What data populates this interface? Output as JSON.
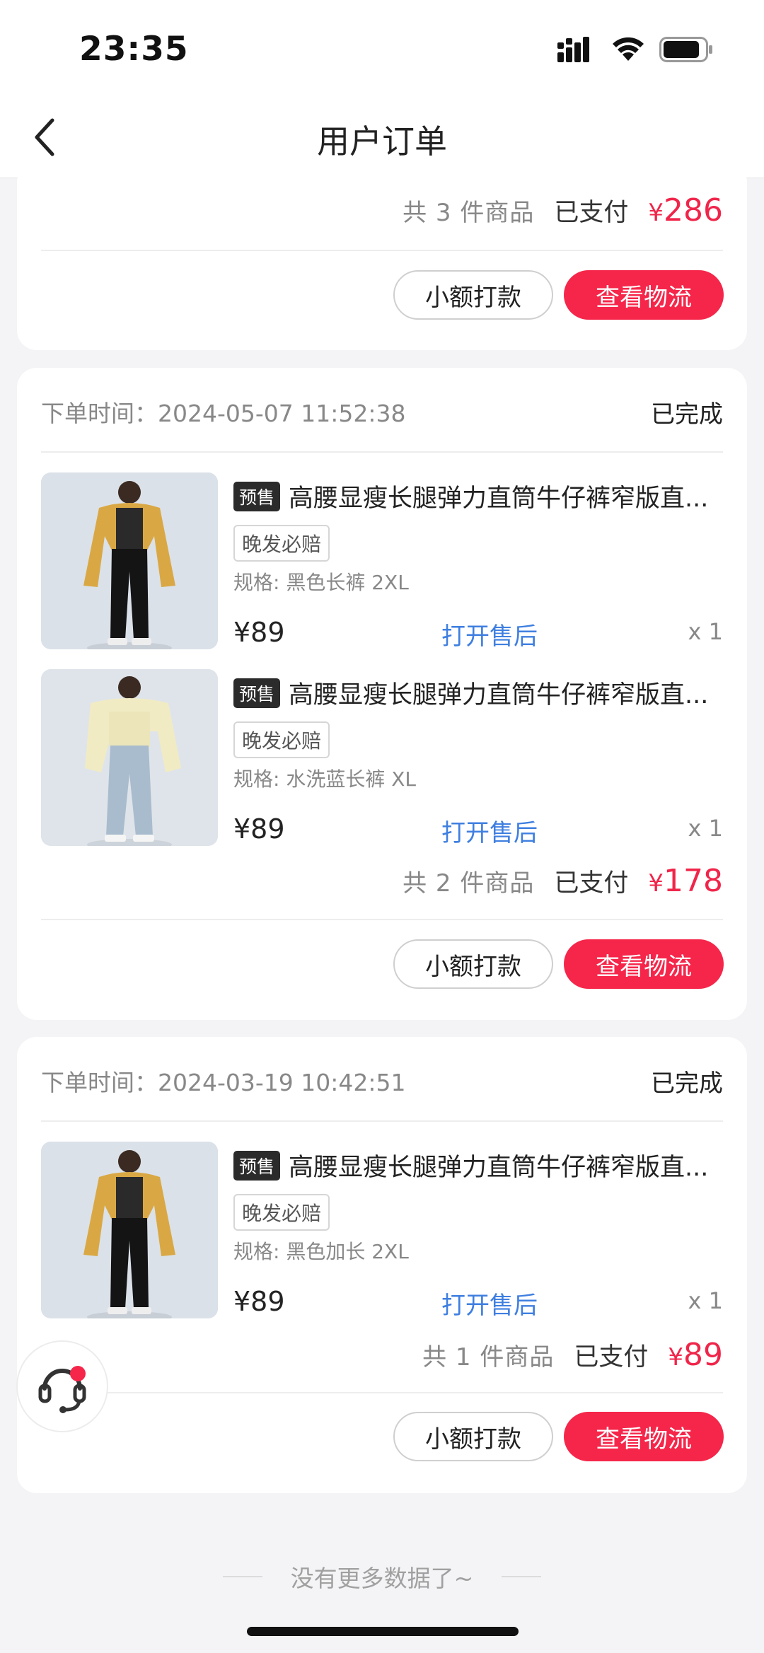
{
  "status_bar": {
    "time": "23:35"
  },
  "nav": {
    "title": "用户订单"
  },
  "orders": [
    {
      "summary": {
        "count": "共 3 件商品",
        "paid_label": "已支付",
        "currency": "¥",
        "amount": "286"
      },
      "buttons": {
        "pay_small": "小额打款",
        "logistics": "查看物流"
      }
    },
    {
      "time_label": "下单时间：2024-05-07 11:52:38",
      "status": "已完成",
      "items": [
        {
          "presale": "预售",
          "title": "高腰显瘦长腿弹力直筒牛仔裤窄版直...",
          "tag": "晚发必赔",
          "spec": "规格: 黑色长裤 2XL",
          "price": "¥89",
          "after_sale": "打开售后",
          "qty": "x 1"
        },
        {
          "presale": "预售",
          "title": "高腰显瘦长腿弹力直筒牛仔裤窄版直...",
          "tag": "晚发必赔",
          "spec": "规格: 水洗蓝长裤 XL",
          "price": "¥89",
          "after_sale": "打开售后",
          "qty": "x 1"
        }
      ],
      "summary": {
        "count": "共 2 件商品",
        "paid_label": "已支付",
        "currency": "¥",
        "amount": "178"
      },
      "buttons": {
        "pay_small": "小额打款",
        "logistics": "查看物流"
      }
    },
    {
      "time_label": "下单时间：2024-03-19 10:42:51",
      "status": "已完成",
      "items": [
        {
          "presale": "预售",
          "title": "高腰显瘦长腿弹力直筒牛仔裤窄版直...",
          "tag": "晚发必赔",
          "spec": "规格: 黑色加长 2XL",
          "price": "¥89",
          "after_sale": "打开售后",
          "qty": "x 1"
        }
      ],
      "summary": {
        "count": "共 1 件商品",
        "paid_label": "已支付",
        "currency": "¥",
        "amount": "89"
      },
      "buttons": {
        "pay_small": "小额打款",
        "logistics": "查看物流"
      }
    }
  ],
  "footer": {
    "end_text": "没有更多数据了~"
  },
  "icons": {
    "back": "chevron-left-icon",
    "support": "headset-icon",
    "signal": "signal-icon",
    "wifi": "wifi-icon",
    "battery": "battery-icon"
  },
  "colors": {
    "accent": "#f5264a",
    "link": "#3f7fe0"
  }
}
